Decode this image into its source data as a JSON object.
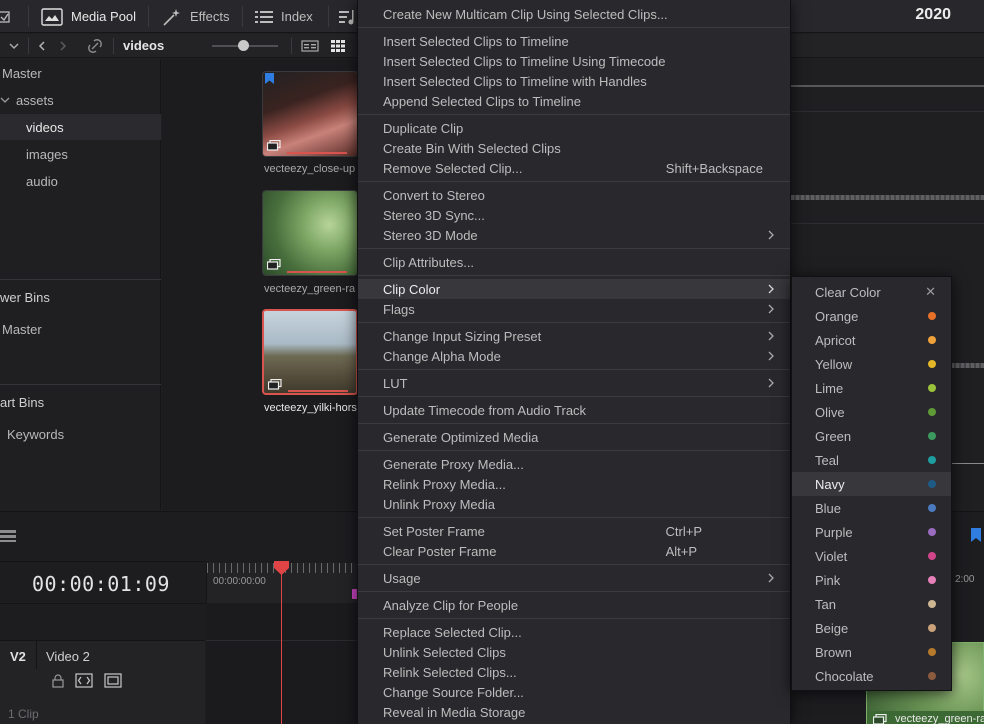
{
  "toolbar": {
    "media_pool": "Media Pool",
    "effects": "Effects",
    "index": "Index",
    "year": "2020"
  },
  "subbar": {
    "bin_title": "videos"
  },
  "bins": {
    "master": "Master",
    "assets": "assets",
    "videos": "videos",
    "images": "images",
    "audio": "audio",
    "power_bins_header": "wer Bins",
    "power_master": "Master",
    "smart_bins_header": "art Bins",
    "keywords": "Keywords"
  },
  "clips": [
    {
      "label": "vecteezy_close-up"
    },
    {
      "label": "vecteezy_green-ra"
    },
    {
      "label": "vecteezy_yilki-hors"
    }
  ],
  "timeline": {
    "timecode": "00:00:01:09",
    "ruler_tc": "00:00:00:00",
    "right_tc": "2:00",
    "track_id": "V2",
    "track_name": "Video 2",
    "clip_count": "1 Clip",
    "right_clip_label": "vecteezy_green-ra"
  },
  "menu": {
    "create_multicam": "Create New Multicam Clip Using Selected Clips...",
    "insert_clips": "Insert Selected Clips to Timeline",
    "insert_timecode": "Insert Selected Clips to Timeline Using Timecode",
    "insert_handles": "Insert Selected Clips to Timeline with Handles",
    "append_clips": "Append Selected Clips to Timeline",
    "duplicate_clip": "Duplicate Clip",
    "create_bin": "Create Bin With Selected Clips",
    "remove_clip": "Remove Selected Clip...",
    "remove_clip_shortcut": "Shift+Backspace",
    "convert_stereo": "Convert to Stereo",
    "stereo_sync": "Stereo 3D Sync...",
    "stereo_mode": "Stereo 3D Mode",
    "clip_attributes": "Clip Attributes...",
    "clip_color": "Clip Color",
    "flags": "Flags",
    "input_sizing": "Change Input Sizing Preset",
    "alpha_mode": "Change Alpha Mode",
    "lut": "LUT",
    "update_timecode": "Update Timecode from Audio Track",
    "optimized_media": "Generate Optimized Media",
    "proxy_media": "Generate Proxy Media...",
    "relink_proxy": "Relink Proxy Media...",
    "unlink_proxy": "Unlink Proxy Media",
    "set_poster": "Set Poster Frame",
    "set_poster_shortcut": "Ctrl+P",
    "clear_poster": "Clear Poster Frame",
    "clear_poster_shortcut": "Alt+P",
    "usage": "Usage",
    "analyze_people": "Analyze Clip for People",
    "replace_clip": "Replace Selected Clip...",
    "unlink_clips": "Unlink Selected Clips",
    "relink_clips": "Relink Selected Clips...",
    "change_source": "Change Source Folder...",
    "reveal_storage": "Reveal in Media Storage"
  },
  "colors": {
    "items": [
      {
        "label": "Clear Color",
        "color": ""
      },
      {
        "label": "Orange",
        "color": "#e8712a"
      },
      {
        "label": "Apricot",
        "color": "#f0a23a"
      },
      {
        "label": "Yellow",
        "color": "#e3b728"
      },
      {
        "label": "Lime",
        "color": "#9bc23b"
      },
      {
        "label": "Olive",
        "color": "#5e9b36"
      },
      {
        "label": "Green",
        "color": "#3c9a5e"
      },
      {
        "label": "Teal",
        "color": "#1f9ea0"
      },
      {
        "label": "Navy",
        "color": "#1e5a86"
      },
      {
        "label": "Blue",
        "color": "#4a7bc0"
      },
      {
        "label": "Purple",
        "color": "#9a6bbf"
      },
      {
        "label": "Violet",
        "color": "#d1448a"
      },
      {
        "label": "Pink",
        "color": "#e680b8"
      },
      {
        "label": "Tan",
        "color": "#cdb592"
      },
      {
        "label": "Beige",
        "color": "#c9a27a"
      },
      {
        "label": "Brown",
        "color": "#b77a2a"
      },
      {
        "label": "Chocolate",
        "color": "#8c5a3d"
      }
    ],
    "highlighted": "Navy"
  }
}
